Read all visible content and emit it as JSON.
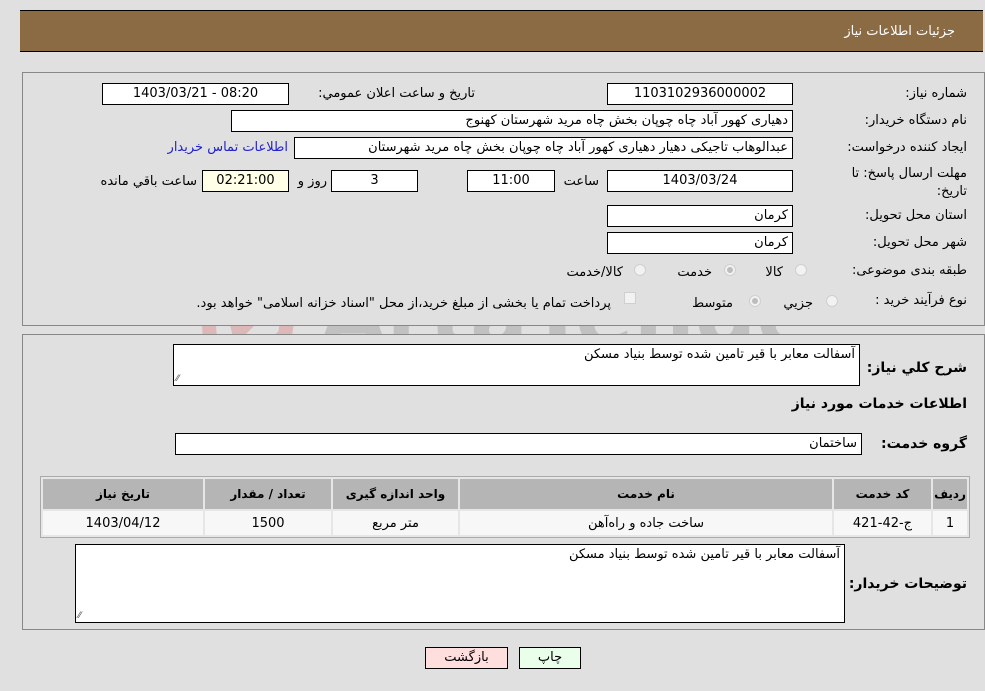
{
  "header": {
    "title": "جزئیات اطلاعات نیاز"
  },
  "fields": {
    "need_number": {
      "label": "شماره نیاز:",
      "value": "1103102936000002"
    },
    "announce_datetime": {
      "label": "تاريخ و ساعت اعلان عمومي:",
      "value": "1403/03/21 - 08:20"
    },
    "buyer_org": {
      "label": "نام دستگاه خريدار:",
      "value": "دهیاری کهور آباد چاه چوپان بخش چاه مرید شهرستان کهنوج"
    },
    "creator": {
      "label": "ايجاد کننده درخواست:",
      "value": "عبدالوهاب تاجیکی دهیار دهیاری کهور آباد چاه چوپان بخش چاه مرید شهرستان"
    },
    "contact_link": "اطلاعات تماس خريدار",
    "deadline": {
      "label": "مهلت ارسال پاسخ: تا تاریخ:",
      "date": "1403/03/24",
      "time_label": "ساعت",
      "time": "11:00",
      "days": "3",
      "days_label": "روز و",
      "remaining": "02:21:00",
      "remaining_label": "ساعت باقي مانده"
    },
    "province": {
      "label": "استان محل تحويل:",
      "value": "کرمان"
    },
    "city": {
      "label": "شهر محل تحويل:",
      "value": "کرمان"
    },
    "category": {
      "label": "طبقه بندی موضوعی:",
      "options": [
        "کالا",
        "خدمت",
        "کالا/خدمت"
      ],
      "selected": "خدمت"
    },
    "purchase_type": {
      "label": "نوع فرآيند خريد :",
      "options": [
        "جزيي",
        "متوسط"
      ],
      "selected": "متوسط",
      "treasury_note": "پرداخت تمام يا بخشی از مبلغ خريد،از محل \"اسناد خزانه اسلامی\" خواهد بود."
    }
  },
  "details": {
    "summary_label": "شرح کلي نياز:",
    "summary_value": "آسفالت معابر با قیر تامین شده توسط بنیاد مسکن",
    "services_heading": "اطلاعات خدمات مورد نياز",
    "service_group_label": "گروه خدمت:",
    "service_group_value": "ساختمان",
    "table": {
      "headers": [
        "رديف",
        "کد خدمت",
        "نام خدمت",
        "واحد اندازه گيری",
        "تعداد / مقدار",
        "تاريخ نياز"
      ],
      "rows": [
        [
          "1",
          "ج-42-421",
          "ساخت جاده و راه‌آهن",
          "متر مربع",
          "1500",
          "1403/04/12"
        ]
      ]
    },
    "buyer_notes_label": "توضيحات خريدار:",
    "buyer_notes_value": "آسفالت معابر با قیر تامین شده توسط بنیاد مسکن"
  },
  "buttons": {
    "print": "چاپ",
    "back": "بازگشت"
  },
  "colors": {
    "header_bg": "#8b6b43",
    "print_bg": "#eaffea",
    "back_bg": "#ffdede",
    "link": "#2222cc"
  }
}
